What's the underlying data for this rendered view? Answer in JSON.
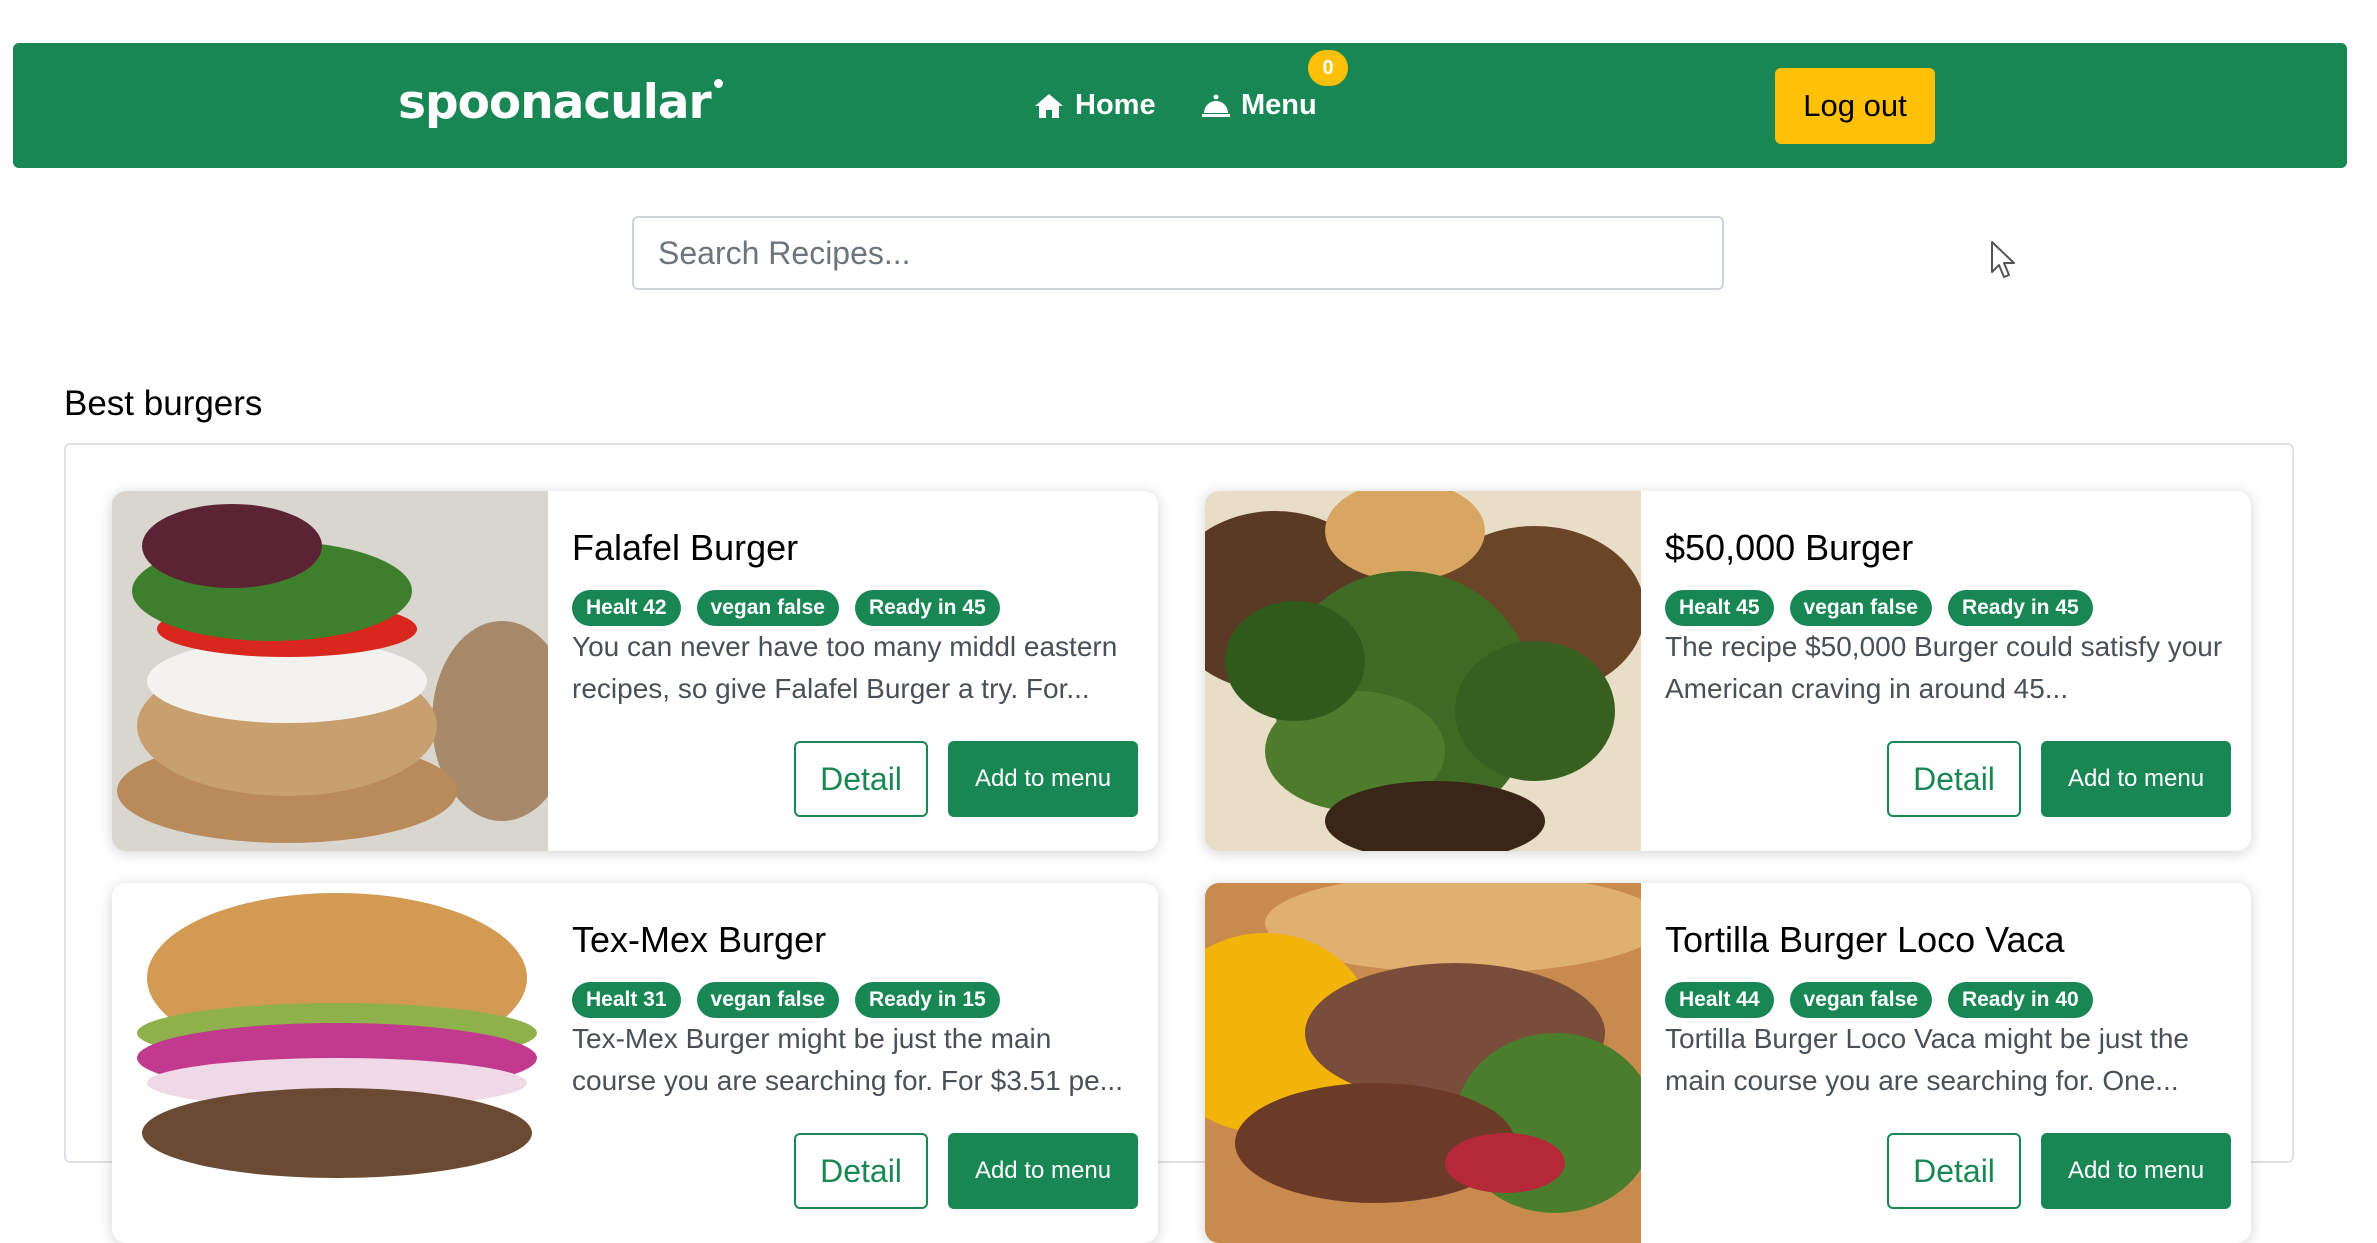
{
  "header": {
    "brand": "spoonacular",
    "nav": [
      {
        "label": "Home",
        "icon": "home-icon"
      },
      {
        "label": "Menu",
        "icon": "bell-icon"
      }
    ],
    "menu_count": "0",
    "logout_label": "Log out"
  },
  "search": {
    "placeholder": "Search Recipes..."
  },
  "section": {
    "title": "Best burgers"
  },
  "recipes": [
    {
      "title": "Falafel Burger",
      "health": "Healt 42",
      "vegan": "vegan false",
      "ready": "Ready in 45",
      "description": "You can never have too many middl eastern recipes, so give Falafel Burger a try. For...",
      "detail_label": "Detail",
      "add_label": "Add to menu"
    },
    {
      "title": "$50,000 Burger",
      "health": "Healt 45",
      "vegan": "vegan false",
      "ready": "Ready in 45",
      "description": "The recipe $50,000 Burger could satisfy your American craving in around 45...",
      "detail_label": "Detail",
      "add_label": "Add to menu"
    },
    {
      "title": "Tex-Mex Burger",
      "health": "Healt 31",
      "vegan": "vegan false",
      "ready": "Ready in 15",
      "description": "Tex-Mex Burger might be just the main course you are searching for. For $3.51 pe...",
      "detail_label": "Detail",
      "add_label": "Add to menu"
    },
    {
      "title": "Tortilla Burger Loco Vaca",
      "health": "Healt 44",
      "vegan": "vegan false",
      "ready": "Ready in 40",
      "description": "Tortilla Burger Loco Vaca might be just the main course you are searching for. One...",
      "detail_label": "Detail",
      "add_label": "Add to menu"
    }
  ],
  "colors": {
    "primary": "#198754",
    "accent": "#ffc107"
  }
}
